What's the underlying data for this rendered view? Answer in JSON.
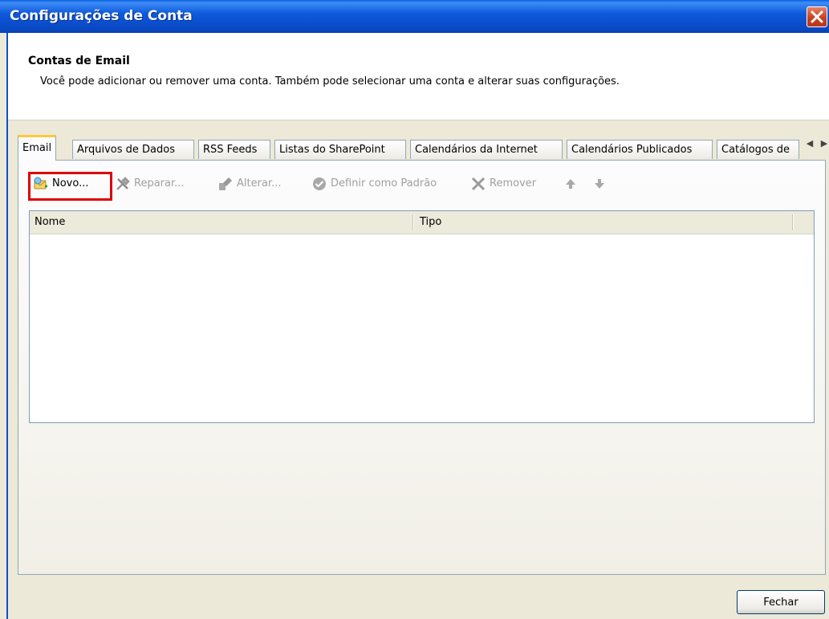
{
  "window": {
    "title": "Configurações de Conta"
  },
  "header": {
    "title": "Contas de Email",
    "description": "Você pode adicionar ou remover uma conta. Também pode selecionar uma conta e alterar suas configurações."
  },
  "tabs": [
    {
      "label": "Email",
      "active": true
    },
    {
      "label": "Arquivos de Dados"
    },
    {
      "label": "RSS Feeds"
    },
    {
      "label": "Listas do SharePoint"
    },
    {
      "label": "Calendários da Internet"
    },
    {
      "label": "Calendários Publicados"
    },
    {
      "label": "Catálogos de"
    }
  ],
  "toolbar": {
    "new_label": "Novo...",
    "repair_label": "Reparar...",
    "change_label": "Alterar...",
    "set_default_label": "Definir como Padrão",
    "remove_label": "Remover"
  },
  "list": {
    "columns": [
      "Nome",
      "Tipo"
    ],
    "rows": []
  },
  "footer": {
    "close_label": "Fechar"
  },
  "colors": {
    "titlebar": "#0a4fcf",
    "highlight": "#e00000",
    "active_tab_accent": "#ffc83c"
  },
  "icons": [
    "close-icon",
    "new-account-icon",
    "repair-icon",
    "change-icon",
    "check-icon",
    "remove-icon",
    "arrow-up-icon",
    "arrow-down-icon",
    "tab-scroll-left-icon",
    "tab-scroll-right-icon"
  ]
}
